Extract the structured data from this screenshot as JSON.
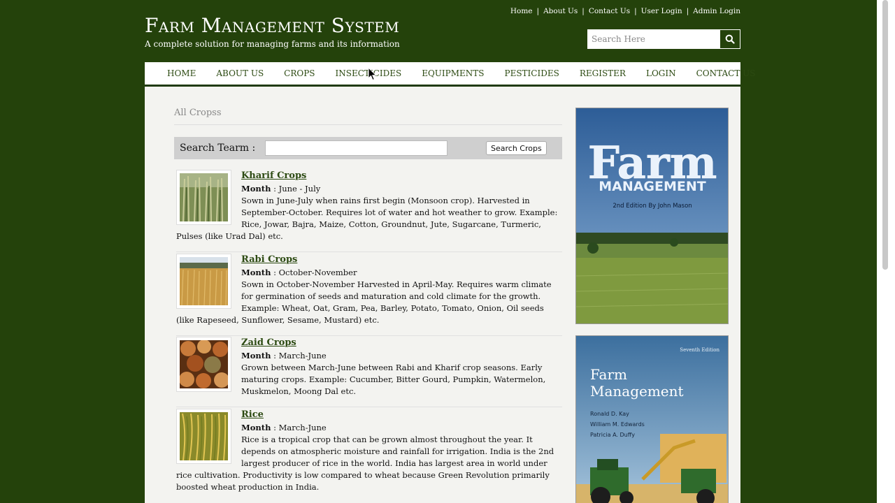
{
  "header": {
    "toplinks": [
      "Home",
      "About Us",
      "Contact Us",
      "User Login",
      "Admin Login"
    ],
    "brand": "Farm Management System",
    "tagline": "A complete solution for managing farms and its information",
    "search_placeholder": "Search Here"
  },
  "nav": [
    "HOME",
    "ABOUT US",
    "CROPS",
    "INSECTICIDES",
    "EQUIPMENTS",
    "PESTICIDES",
    "REGISTER",
    "LOGIN",
    "CONTACT US"
  ],
  "main": {
    "breadcrumb": "All Cropss",
    "search_label": "Search Tearm :",
    "search_button": "Search Crops",
    "crops": [
      {
        "title": "Kharif Crops",
        "month_label": "Month",
        "month": ": June - July",
        "desc": "Sown in June-July when rains first begin (Monsoon crop). Harvested in September-October. Requires lot of water and hot weather to grow. Example: Rice, Jowar, Bajra, Maize, Cotton, Groundnut, Jute, Sugarcane, Turmeric, Pulses (like Urad Dal) etc."
      },
      {
        "title": "Rabi Crops",
        "month_label": "Month",
        "month": ": October-November",
        "desc": "Sown in October-November Harvested in April-May. Requires warm climate for germination of seeds and maturation and cold climate for the growth. Example: Wheat, Oat, Gram, Pea, Barley, Potato, Tomato, Onion, Oil seeds (like Rapeseed, Sunflower, Sesame, Mustard) etc."
      },
      {
        "title": "Zaid Crops",
        "month_label": "Month",
        "month": ": March-June",
        "desc": "Grown between March-June between Rabi and Kharif crop seasons. Early maturing crops. Example: Cucumber, Bitter Gourd, Pumpkin, Watermelon, Muskmelon, Moong Dal etc."
      },
      {
        "title": "Rice",
        "month_label": "Month",
        "month": ": March-June",
        "desc": "Rice is a tropical crop that can be grown almost throughout the year. It depends on atmospheric moisture and rainfall for irrigation. India is the 2nd largest producer of rice in the world. India has largest area in world under rice cultivation. Productivity is low compared to wheat because Green Revolution primarily boosted wheat production in India."
      }
    ]
  },
  "sidebar": {
    "book1_title": "Farm",
    "book1_subtitle": "MANAGEMENT",
    "book1_edition": "2nd Edition By John Mason",
    "book2_edition": "Seventh Edition",
    "book2_title1": "Farm",
    "book2_title2": "Management",
    "book2_authors": [
      "Ronald D. Kay",
      "William M. Edwards",
      "Patricia A. Duffy"
    ]
  }
}
